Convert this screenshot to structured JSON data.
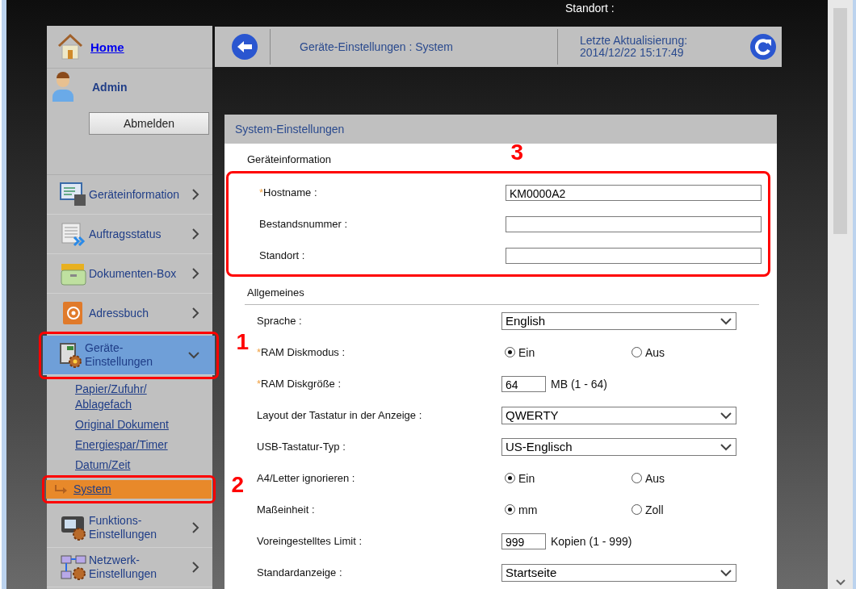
{
  "topbar": {
    "location_label": "Standort :"
  },
  "sidebar": {
    "home": "Home",
    "user": "Admin",
    "logout_button": "Abmelden",
    "nav": [
      {
        "label": "Geräteinformation",
        "kind": "device-info",
        "expanded": false,
        "selected": false
      },
      {
        "label": "Auftragsstatus",
        "kind": "job-status",
        "expanded": false,
        "selected": false
      },
      {
        "label": "Dokumenten-Box",
        "kind": "document-box",
        "expanded": false,
        "selected": false
      },
      {
        "label": "Adressbuch",
        "kind": "address-book",
        "expanded": false,
        "selected": false
      },
      {
        "label": "Geräte-Einstellungen",
        "kind": "device-settings",
        "expanded": true,
        "selected": true,
        "callout": "1",
        "children": [
          {
            "label": "Papier/Zufuhr/\nAblagefach",
            "selected": false
          },
          {
            "label": "Original Dokument",
            "selected": false
          },
          {
            "label": "Energiespar/Timer",
            "selected": false
          },
          {
            "label": "Datum/Zeit",
            "selected": false
          },
          {
            "label": "System",
            "selected": true,
            "callout": "2"
          }
        ]
      },
      {
        "label": "Funktions-Einstellungen",
        "kind": "function-settings",
        "expanded": false,
        "selected": false
      },
      {
        "label": "Netzwerk-Einstellungen",
        "kind": "network-settings",
        "expanded": false,
        "selected": false
      }
    ]
  },
  "header": {
    "breadcrumb": "Geräte-Einstellungen : System",
    "last_update_label": "Letzte Aktualisierung:",
    "last_update": "2014/12/22 15:17:49"
  },
  "panel": {
    "title": "System-Einstellungen",
    "sections": [
      {
        "title": "Geräteinformation",
        "callout": "3",
        "fields": [
          {
            "label": "Hostname :",
            "required_mark": "*",
            "kind": "text",
            "value": "KM0000A2"
          },
          {
            "label": "Bestandsnummer :",
            "kind": "text"
          },
          {
            "label": "Standort :",
            "kind": "text"
          }
        ]
      },
      {
        "title": "Allgemeines",
        "fields": [
          {
            "label": "Sprache :",
            "kind": "select",
            "value": "English"
          },
          {
            "label": "RAM Diskmodus :",
            "required_mark": "*",
            "kind": "radio",
            "options": [
              {
                "label": "Ein",
                "selected": true
              },
              {
                "label": "Aus",
                "selected": false
              }
            ]
          },
          {
            "label": "RAM Diskgröße :",
            "required_mark": "*",
            "kind": "number",
            "value": "64",
            "unit": "MB (1 - 64)"
          },
          {
            "label": "Layout der Tastatur in der Anzeige :",
            "kind": "select",
            "value": "QWERTY"
          },
          {
            "label": "USB-Tastatur-Typ :",
            "kind": "select",
            "value": "US-Englisch"
          },
          {
            "label": "A4/Letter ignorieren :",
            "kind": "radio",
            "options": [
              {
                "label": "Ein",
                "selected": true
              },
              {
                "label": "Aus",
                "selected": false
              }
            ]
          },
          {
            "label": "Maßeinheit :",
            "kind": "radio",
            "options": [
              {
                "label": "mm",
                "selected": true
              },
              {
                "label": "Zoll",
                "selected": false
              }
            ]
          },
          {
            "label": "Voreingestelltes Limit :",
            "kind": "number",
            "value": "999",
            "unit": "Kopien (1 - 999)"
          },
          {
            "label": "Standardanzeige :",
            "kind": "select",
            "value": "Startseite"
          }
        ]
      }
    ]
  }
}
